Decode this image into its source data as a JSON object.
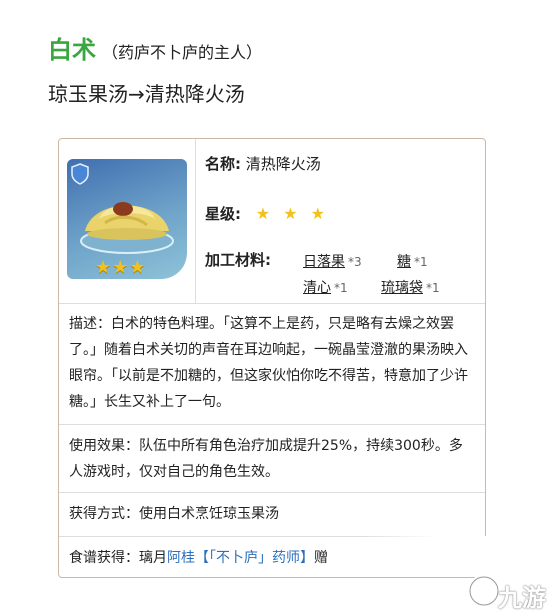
{
  "heading": {
    "name": "白术",
    "subtitle": "（药庐不卜庐的主人）"
  },
  "recipe_line": "琼玉果汤→清热降火汤",
  "card": {
    "name_label": "名称:",
    "name_value": "清热降火汤",
    "rarity_label": "星级:",
    "rarity_stars": "★ ★ ★",
    "icon_rarity": "★★★",
    "materials_label": "加工材料:",
    "materials": [
      {
        "name": "日落果",
        "qty": "*3"
      },
      {
        "name": "糖",
        "qty": "*1"
      },
      {
        "name": "清心",
        "qty": "*1"
      },
      {
        "name": "琉璃袋",
        "qty": "*1"
      }
    ],
    "description": "描述：白术的特色料理。「这算不上是药，只是略有去燥之效罢了。」随着白术关切的声音在耳边响起，一碗晶莹澄澈的果汤映入眼帘。「以前是不加糖的，但这家伙怕你吃不得苦，特意加了少许糖。」长生又补上了一句。",
    "effect": "使用效果：队伍中所有角色治疗加成提升25%，持续300秒。多人游戏时，仅对自己的角色生效。",
    "obtain": "获得方式：使用白术烹饪琼玉果汤",
    "recipe_prefix": "食谱获得：璃月",
    "recipe_link": "阿桂【「不卜庐」药师】",
    "recipe_suffix": "赠"
  },
  "watermark": {
    "text": "九游"
  },
  "colors": {
    "name_green": "#3aa63f",
    "star_gold": "#f2c21b",
    "link_blue": "#2d6fbd",
    "card_border": "#c9b9a8"
  }
}
